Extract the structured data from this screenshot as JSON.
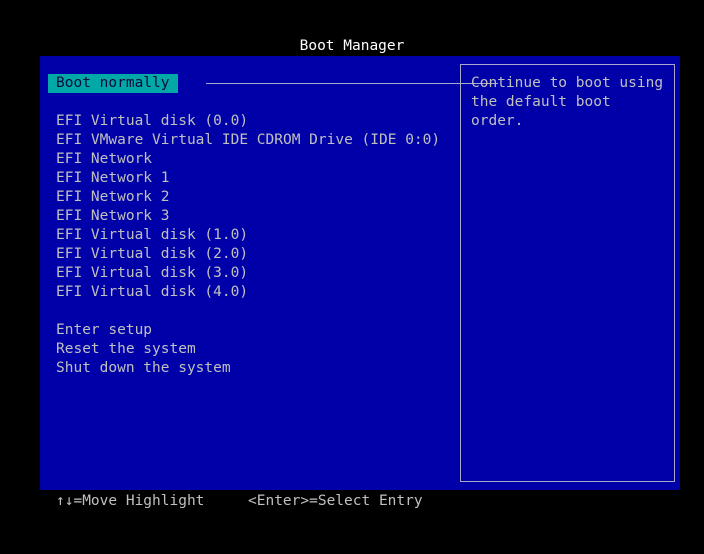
{
  "title": "Boot Manager",
  "menu": {
    "items": [
      "Boot normally",
      "EFI Virtual disk (0.0)",
      "EFI VMware Virtual IDE CDROM Drive (IDE 0:0)",
      "EFI Network",
      "EFI Network 1",
      "EFI Network 2",
      "EFI Network 3",
      "EFI Virtual disk (1.0)",
      "EFI Virtual disk (2.0)",
      "EFI Virtual disk (3.0)",
      "EFI Virtual disk (4.0)",
      "Enter setup",
      "Reset the system",
      "Shut down the system"
    ]
  },
  "help": {
    "text": "Continue to boot using the default boot order."
  },
  "footer": {
    "move_hint": "↑↓=Move Highlight",
    "select_hint": "<Enter>=Select Entry"
  },
  "colors": {
    "panel_background": "#0000a8",
    "highlight": "#00a8a8",
    "text": "#c0c0c0",
    "title": "#ffffff"
  }
}
